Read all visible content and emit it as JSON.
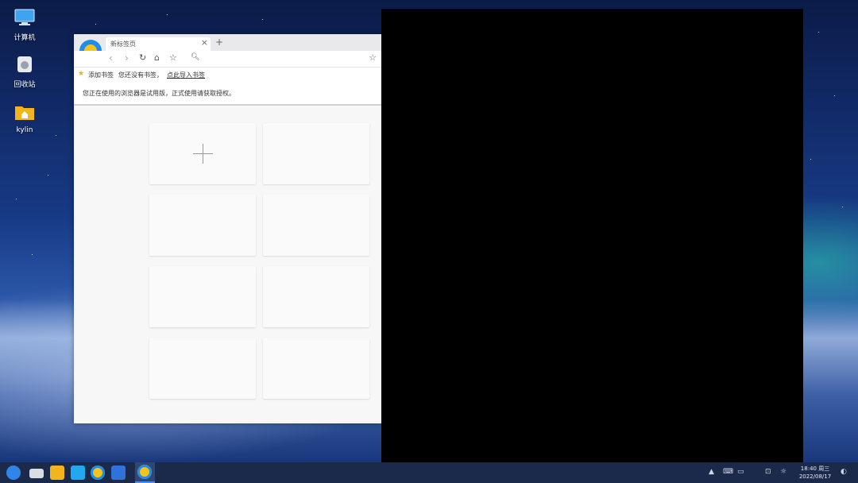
{
  "desktop": {
    "icons": [
      {
        "label": "计算机",
        "icon": "computer-icon"
      },
      {
        "label": "回收站",
        "icon": "trash-icon"
      },
      {
        "label": "kylin",
        "icon": "home-folder-icon"
      }
    ]
  },
  "browser": {
    "tab_title": "新标签页",
    "tab_close": "×",
    "new_tab": "+",
    "bookmark_bar": {
      "add_label": "添加书签",
      "none_text": "您还没有书签，",
      "import_link": "点此导入书签"
    },
    "notice": "您正在使用的浏览器是试用版，正式使用请获取授权。",
    "tiles_count": 8
  },
  "taskbar": {
    "apps": [
      "start-menu-icon",
      "multitask-icon",
      "file-manager-icon",
      "software-store-icon",
      "browser-icon",
      "wps-writer-icon"
    ],
    "time": "18:40 周三",
    "date": "2022/08/17"
  },
  "colors": {
    "taskbar_bg": "#1b2a4b",
    "accent": "#4a8df0"
  }
}
